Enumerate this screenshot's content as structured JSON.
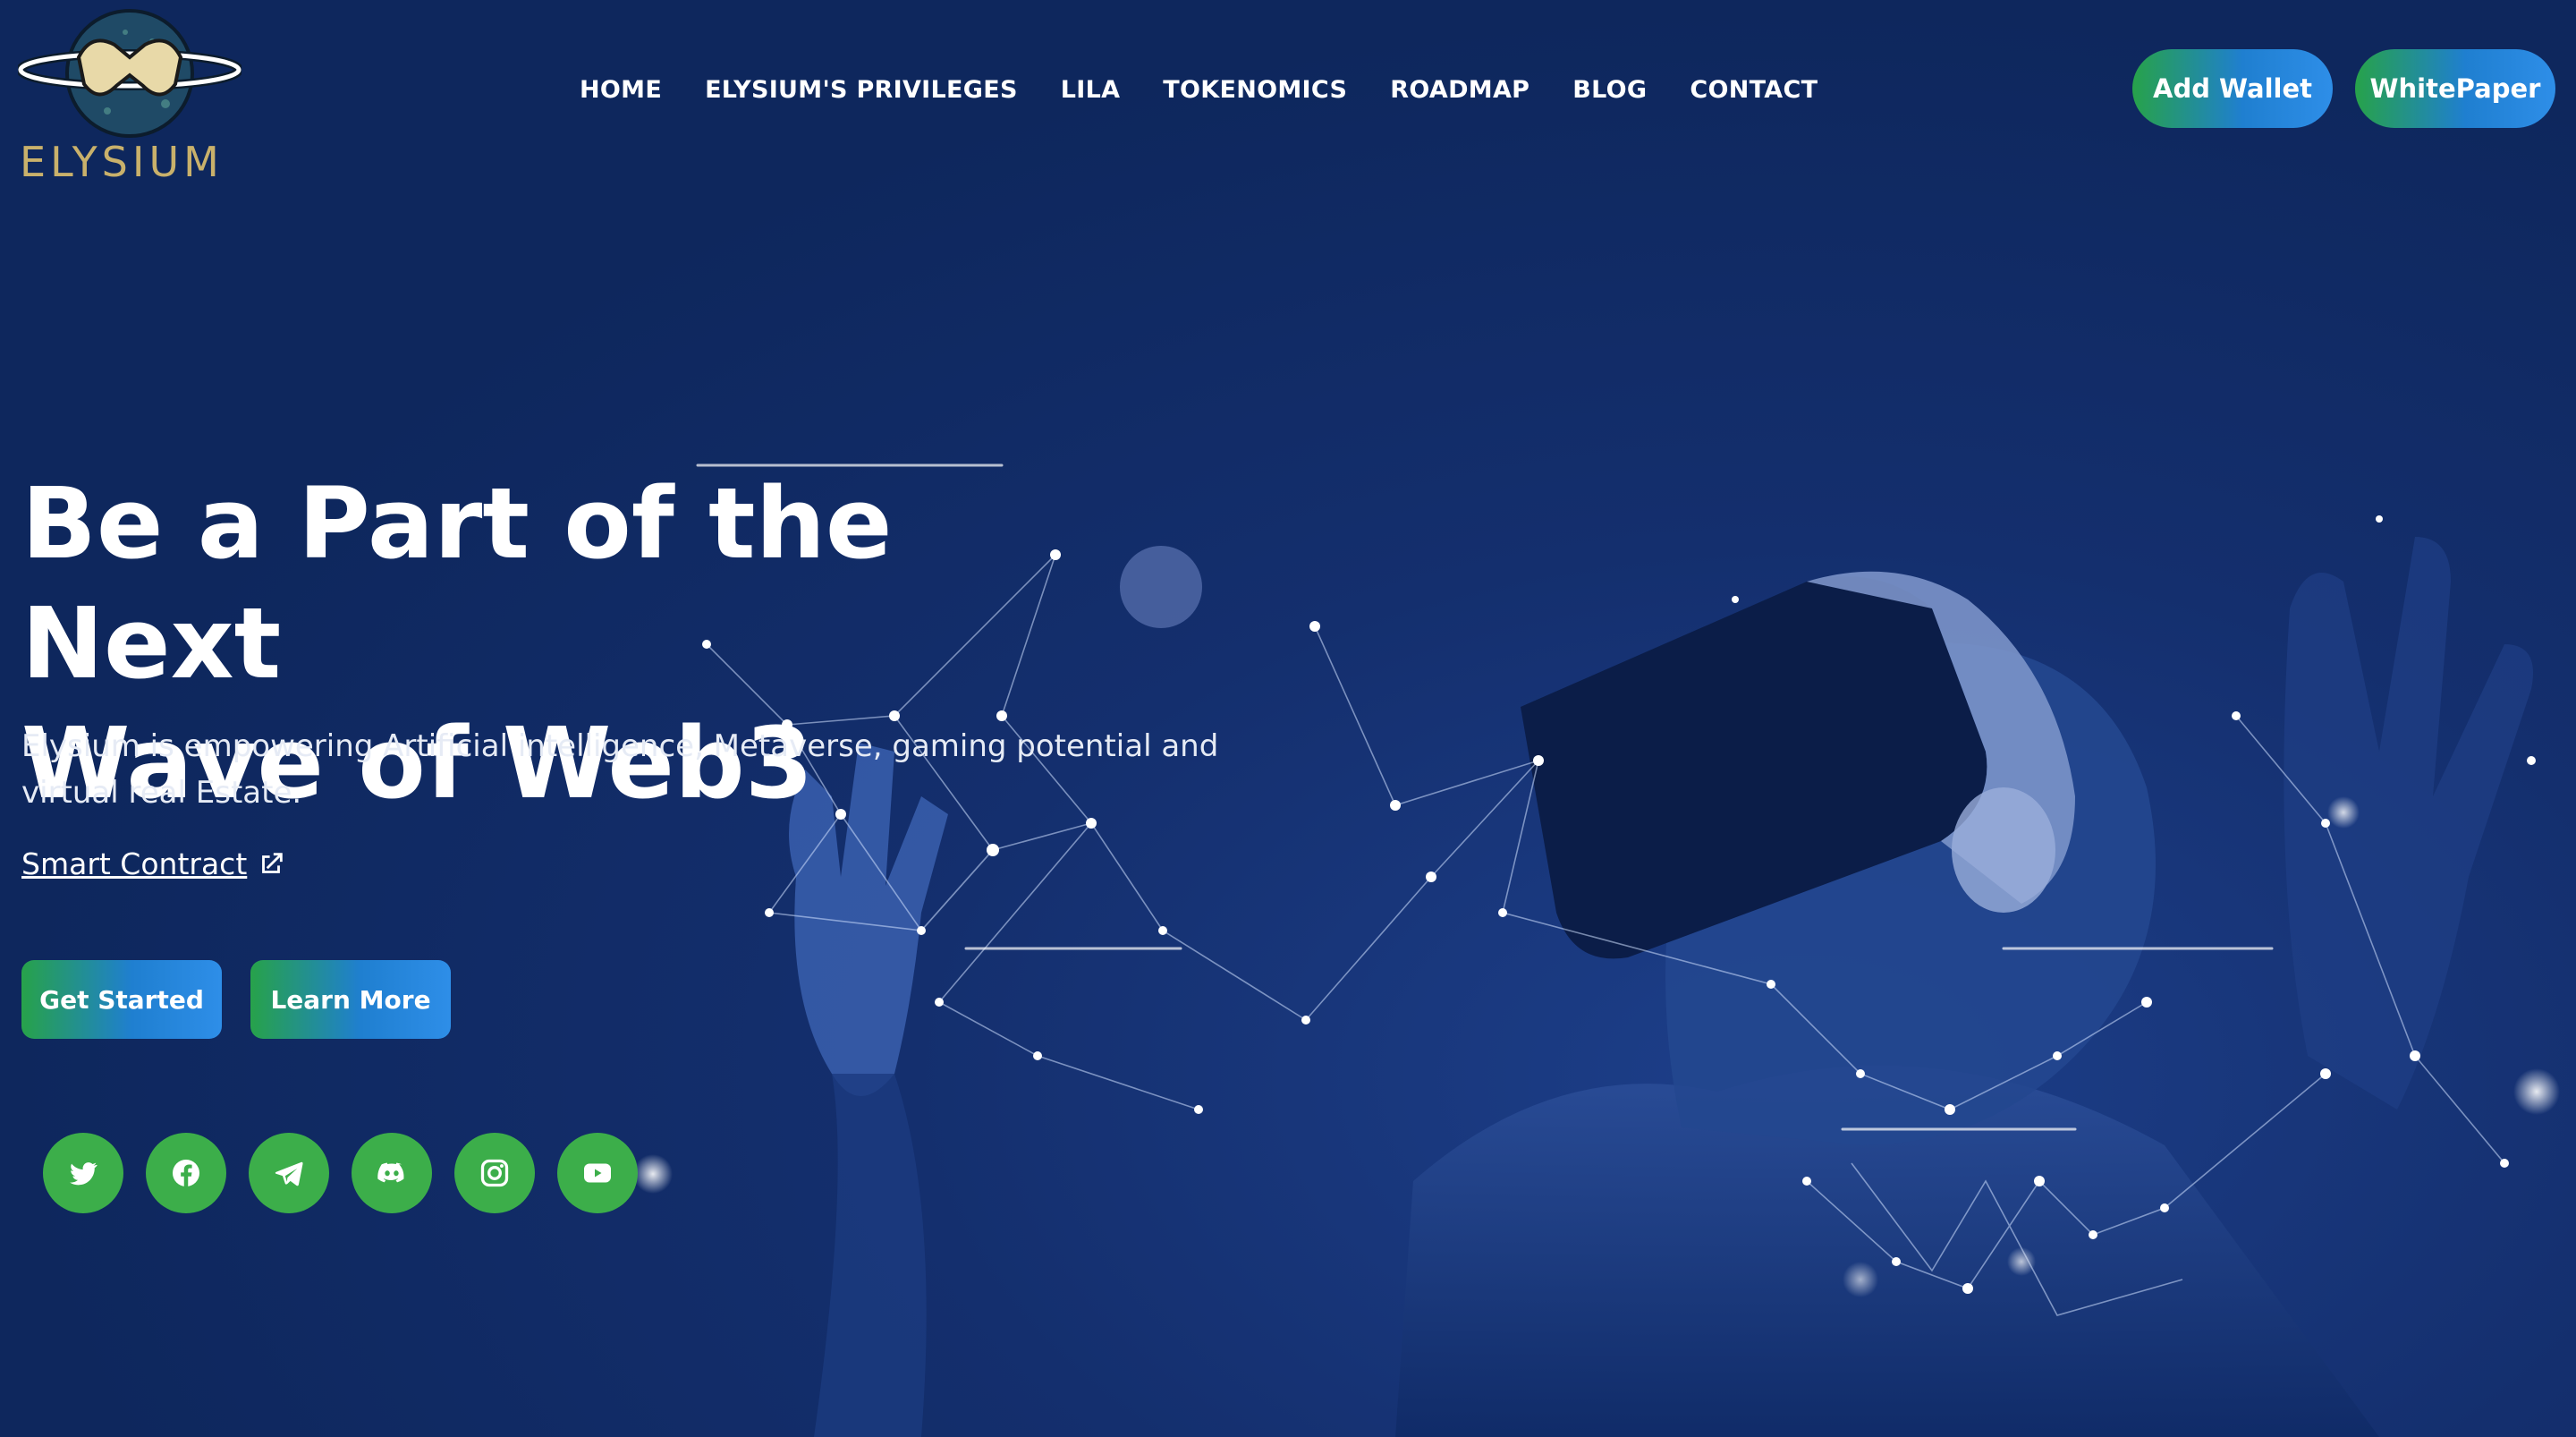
{
  "brand": {
    "name": "ELYSIUM"
  },
  "nav": {
    "items": [
      {
        "label": "HOME"
      },
      {
        "label": "ELYSIUM'S PRIVILEGES"
      },
      {
        "label": "LILA"
      },
      {
        "label": "TOKENOMICS"
      },
      {
        "label": "ROADMAP"
      },
      {
        "label": "BLOG"
      },
      {
        "label": "CONTACT"
      }
    ]
  },
  "header_buttons": {
    "add_wallet": "Add Wallet",
    "whitepaper": "WhitePaper"
  },
  "hero": {
    "title_line1": "Be a Part of the Next",
    "title_line2": "Wave of Web3",
    "subtitle_line1": "Elysium is empowering Artificial intelligence, Metaverse, gaming potential and",
    "subtitle_line2": "virtual real Estate.",
    "smart_contract": "Smart Contract",
    "get_started": "Get Started",
    "learn_more": "Learn More"
  },
  "social": [
    {
      "icon": "twitter-icon"
    },
    {
      "icon": "facebook-icon"
    },
    {
      "icon": "telegram-icon"
    },
    {
      "icon": "discord-icon"
    },
    {
      "icon": "instagram-icon"
    },
    {
      "icon": "youtube-icon"
    }
  ],
  "colors": {
    "background": "#0e275d",
    "accent_green": "#3cae4a",
    "gradient_blue": "#2e8ee8",
    "logo_gold": "#c9b16b"
  }
}
